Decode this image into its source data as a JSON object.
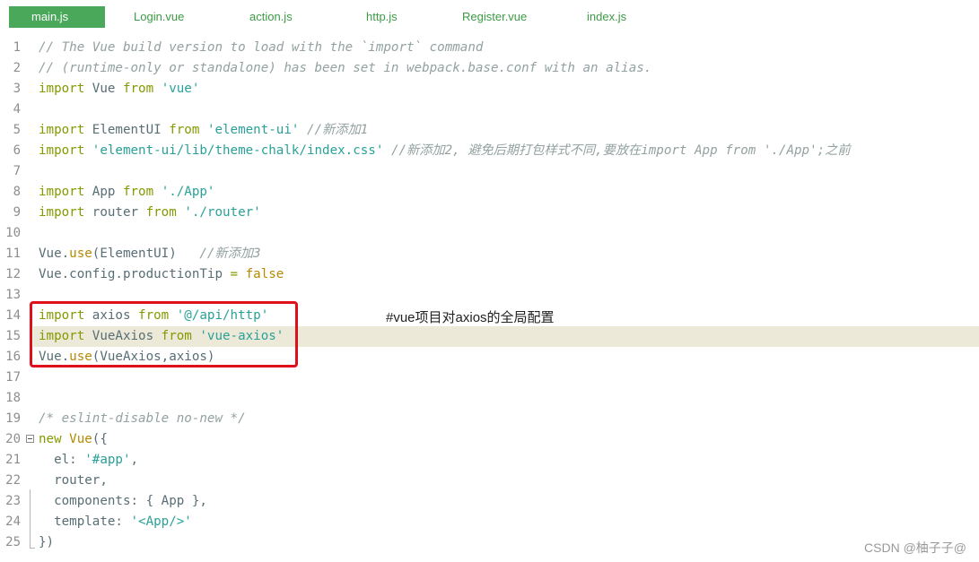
{
  "tabs": [
    {
      "label": "main.js",
      "active": true
    },
    {
      "label": "Login.vue"
    },
    {
      "label": "action.js"
    },
    {
      "label": "http.js"
    },
    {
      "label": "Register.vue"
    },
    {
      "label": "index.js"
    }
  ],
  "code_lines": [
    "1",
    "2",
    "3",
    "4",
    "5",
    "6",
    "7",
    "8",
    "9",
    "10",
    "11",
    "12",
    "13",
    "14",
    "15",
    "16",
    "17",
    "18",
    "19",
    "20",
    "21",
    "22",
    "23",
    "24",
    "25"
  ],
  "code": {
    "l1": "// The Vue build version to load with the `import` command",
    "l2": "// (runtime-only or standalone) has been set in webpack.base.conf with an alias.",
    "l5c": "//新添加1",
    "l6c": "//新添加2, 避免后期打包样式不同,要放在import App from './App';之前",
    "l11c": "//新添加3",
    "l19": "/* eslint-disable no-new */"
  },
  "annotation": "#vue项目对axios的全局配置",
  "watermark": "CSDN @柚子子@",
  "colors": {
    "keyword": "#859900",
    "string": "#2aa198",
    "comment": "#93a1a1",
    "highlight_box": "#e0101a",
    "tab_active": "#4aa85a"
  }
}
